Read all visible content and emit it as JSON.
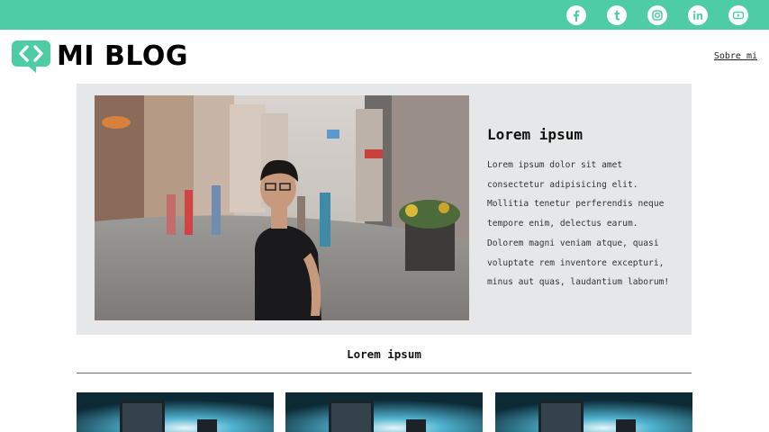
{
  "colors": {
    "accent": "#4ecca3",
    "hero_bg": "#e6e7e8",
    "text": "#111111"
  },
  "social": [
    {
      "name": "facebook",
      "icon": "facebook-icon"
    },
    {
      "name": "tumblr",
      "icon": "tumblr-icon"
    },
    {
      "name": "instagram",
      "icon": "instagram-icon"
    },
    {
      "name": "linkedin",
      "icon": "linkedin-icon"
    },
    {
      "name": "youtube",
      "icon": "youtube-icon"
    }
  ],
  "header": {
    "logo_text": "MI BLOG",
    "logo_icon": "code-brackets-icon",
    "about_link": "Sobre mi"
  },
  "hero": {
    "title": "Lorem ipsum",
    "body": "Lorem ipsum dolor sit amet consectetur adipisicing elit. Mollitia tenetur perferendis neque tempore enim, delectus earum. Dolorem magni veniam atque, quasi voluptate rem inventore excepturi, minus aut quas, laudantium laborum!"
  },
  "section": {
    "title": "Lorem ipsum"
  }
}
